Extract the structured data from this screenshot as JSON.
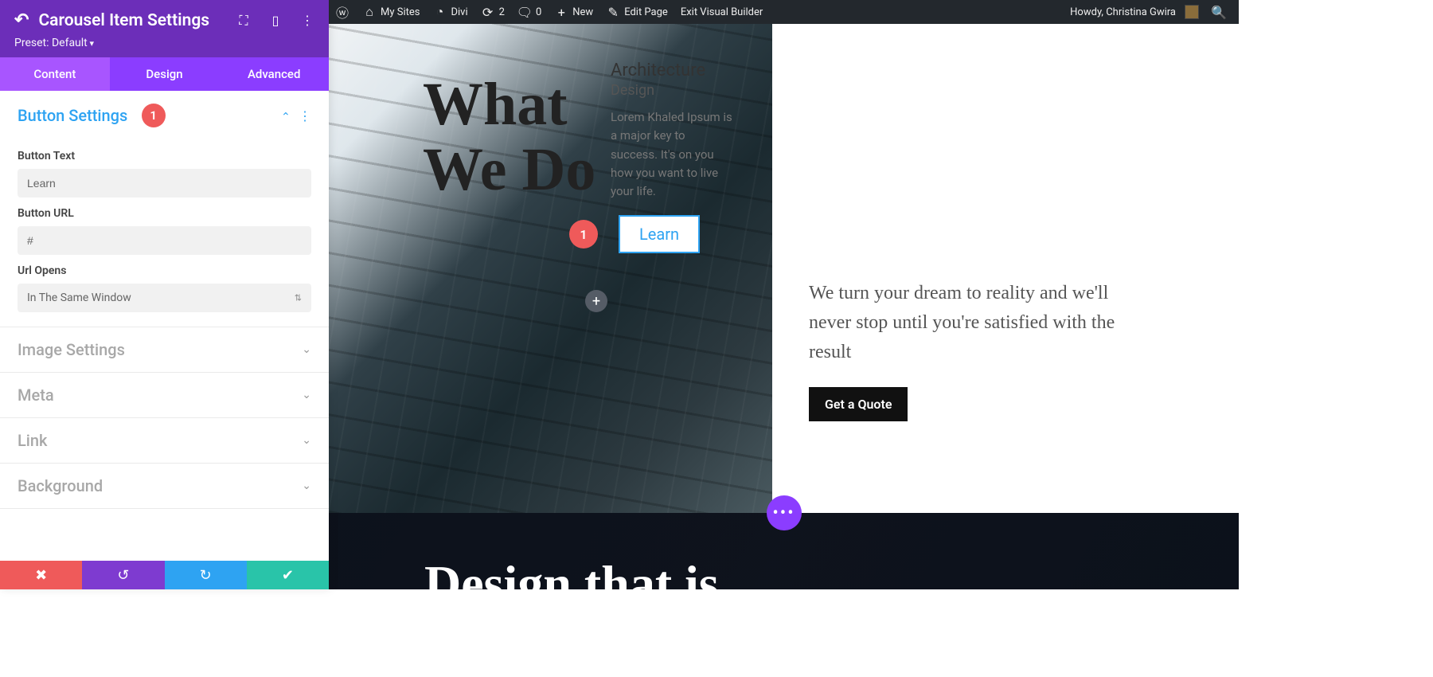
{
  "wp_bar": {
    "my_sites": "My Sites",
    "divi": "Divi",
    "updates": "2",
    "comments": "0",
    "new": "New",
    "edit_page": "Edit Page",
    "exit_vb": "Exit Visual Builder",
    "howdy": "Howdy, Christina Gwira"
  },
  "panel": {
    "title": "Carousel Item Settings",
    "preset": "Preset: Default"
  },
  "tabs": {
    "content": "Content",
    "design": "Design",
    "advanced": "Advanced"
  },
  "sections": {
    "button_settings": {
      "title": "Button Settings",
      "badge": "1",
      "button_text_label": "Button Text",
      "button_text_value": "Learn",
      "button_url_label": "Button URL",
      "button_url_value": "#",
      "url_opens_label": "Url Opens",
      "url_opens_value": "In The Same Window"
    },
    "image_settings": "Image Settings",
    "meta": "Meta",
    "link": "Link",
    "background": "Background"
  },
  "preview": {
    "headline_line1": "What",
    "headline_line2": "We Do",
    "card_title": "Architecture",
    "card_sub": "Design",
    "card_body": "Lorem Khaled Ipsum is a major key to success. It's on you how you want to live your life.",
    "card_btn": "Learn",
    "card_badge": "1",
    "tagline": "We turn your dream to reality and we'll never stop until you're satisfied with the result",
    "quote_btn": "Get a Quote",
    "dark_headline": "Design that is"
  }
}
